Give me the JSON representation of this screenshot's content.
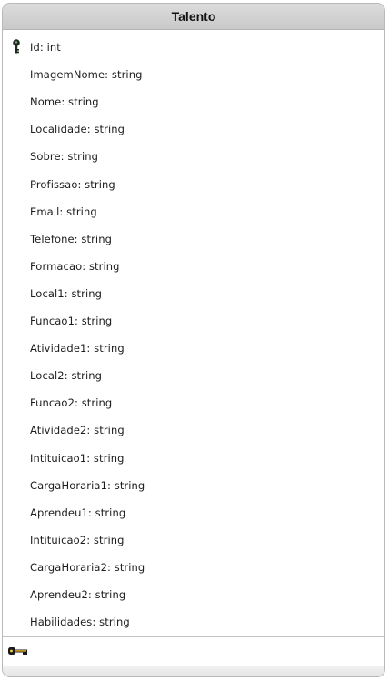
{
  "entity": {
    "title": "Talento",
    "primary_key_icon": "primary-key-icon",
    "foreign_key_icon": "key-icon",
    "fields": [
      {
        "label": "Id: int",
        "is_primary_key": true
      },
      {
        "label": "ImagemNome: string",
        "is_primary_key": false
      },
      {
        "label": "Nome: string",
        "is_primary_key": false
      },
      {
        "label": "Localidade: string",
        "is_primary_key": false
      },
      {
        "label": "Sobre: string",
        "is_primary_key": false
      },
      {
        "label": "Profissao: string",
        "is_primary_key": false
      },
      {
        "label": "Email: string",
        "is_primary_key": false
      },
      {
        "label": "Telefone: string",
        "is_primary_key": false
      },
      {
        "label": "Formacao: string",
        "is_primary_key": false
      },
      {
        "label": "Local1: string",
        "is_primary_key": false
      },
      {
        "label": "Funcao1: string",
        "is_primary_key": false
      },
      {
        "label": "Atividade1: string",
        "is_primary_key": false
      },
      {
        "label": "Local2: string",
        "is_primary_key": false
      },
      {
        "label": "Funcao2: string",
        "is_primary_key": false
      },
      {
        "label": "Atividade2: string",
        "is_primary_key": false
      },
      {
        "label": "Intituicao1: string",
        "is_primary_key": false
      },
      {
        "label": "CargaHoraria1: string",
        "is_primary_key": false
      },
      {
        "label": "Aprendeu1: string",
        "is_primary_key": false
      },
      {
        "label": "Intituicao2: string",
        "is_primary_key": false
      },
      {
        "label": "CargaHoraria2: string",
        "is_primary_key": false
      },
      {
        "label": "Aprendeu2: string",
        "is_primary_key": false
      },
      {
        "label": "Habilidades: string",
        "is_primary_key": false
      }
    ]
  }
}
